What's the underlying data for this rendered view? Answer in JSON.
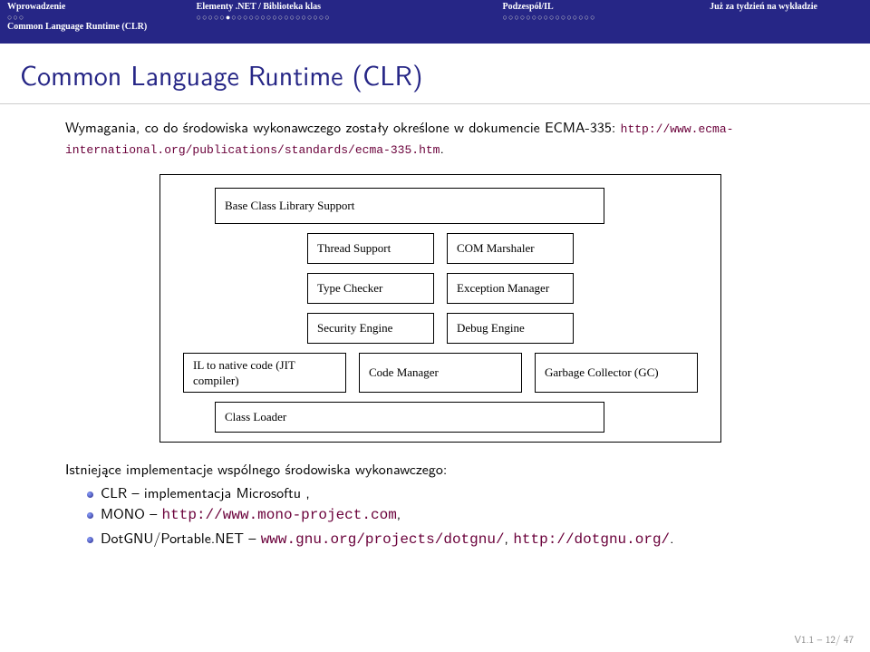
{
  "nav": [
    {
      "label": "Wprowadzenie",
      "dots": "○○○"
    },
    {
      "label": "Elementy .NET / Biblioteka klas",
      "dots_pre": "○○○○○",
      "dots_cur": "●",
      "dots_post": "○○○○○○○○○○○○○○○○○"
    },
    {
      "label": "Podzespół/IL",
      "dots": "○○○○○○○○○○○○○○○○"
    },
    {
      "label": "Już za tydzień na wykładzie"
    }
  ],
  "subsection": "Common Language Runtime (CLR)",
  "title": "Common Language Runtime (CLR)",
  "intro1": "Wymagania, co do środowiska wykonawczego zostały określone w dokumencie ECMA-335: ",
  "intro_url": "http://www.ecma-international.org/publications/standards/ecma-335.htm",
  "period": ".",
  "diagram": {
    "bcl": "Base Class Library Support",
    "row2a": "Thread Support",
    "row2b": "COM Marshaler",
    "row3a": "Type Checker",
    "row3b": "Exception Manager",
    "row4a": "Security Engine",
    "row4b": "Debug Engine",
    "row5a": "IL to native code (JIT compiler)",
    "row5b": "Code Manager",
    "row5c": "Garbage Collector (GC)",
    "loader": "Class Loader"
  },
  "impl_intro": "Istniejące implementacje wspólnego środowiska wykonawczego:",
  "bullets": [
    {
      "pre": "CLR – implementacja Microsoftu ,",
      "url": ""
    },
    {
      "pre": "MONO – ",
      "url": "http://www.mono-project.com",
      "post": ","
    },
    {
      "pre": "DotGNU/Portable.NET – ",
      "url": "www.gnu.org/projects/dotgnu/",
      "post": ", ",
      "url2": "http://dotgnu.org/",
      "post2": "."
    }
  ],
  "footer": "V1.1 – 12/ 47"
}
